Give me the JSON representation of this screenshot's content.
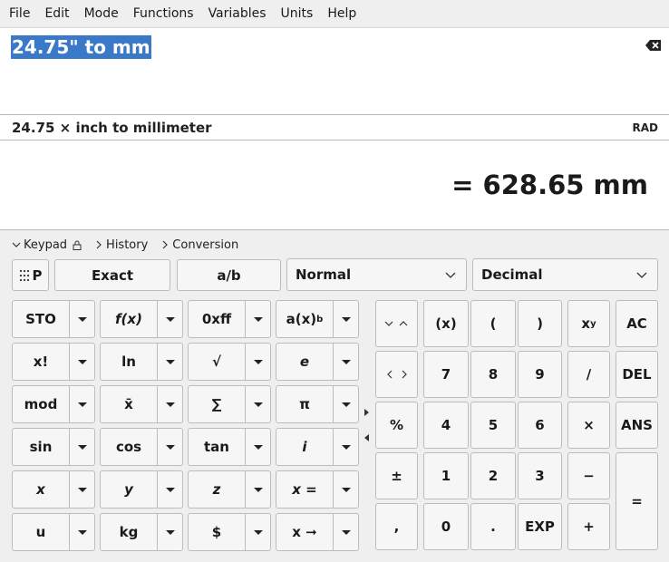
{
  "menu": [
    "File",
    "Edit",
    "Mode",
    "Functions",
    "Variables",
    "Units",
    "Help"
  ],
  "expression": "24.75\" to mm",
  "parsed": "24.75 × inch to millimeter",
  "angle_mode": "RAD",
  "result": "= 628.65 mm",
  "tabs": {
    "keypad": "Keypad",
    "history": "History",
    "conversion": "Conversion"
  },
  "toolbar": {
    "p_label": "P",
    "exact": "Exact",
    "fraction": "a/b",
    "display_mode": "Normal",
    "base": "Decimal"
  },
  "fn_keys": [
    [
      "STO",
      "f(x)",
      "0xff",
      "a(x)"
    ],
    [
      "x!",
      "ln",
      "√",
      "e"
    ],
    [
      "mod",
      "x̄",
      "∑",
      "π"
    ],
    [
      "sin",
      "cos",
      "tan",
      "i"
    ],
    [
      "x",
      "y",
      "z",
      "x ="
    ],
    [
      "u",
      "kg",
      "$",
      "x ➞"
    ]
  ],
  "fn_superscript": "b",
  "numpad": {
    "row1": [
      "(x)",
      "(",
      ")",
      "x",
      "AC"
    ],
    "power_sup": "y",
    "row2": [
      "7",
      "8",
      "9",
      "∕",
      "DEL"
    ],
    "row3": [
      "%",
      "4",
      "5",
      "6",
      "×",
      "ANS"
    ],
    "row4": [
      "±",
      "1",
      "2",
      "3",
      "−"
    ],
    "row5": [
      ",",
      "0",
      ".",
      "EXP",
      "+"
    ],
    "equals": "="
  },
  "icons": {
    "clear": "backspace-icon",
    "updown": "up-down-chevron-icon",
    "leftright": "left-right-chevron-icon",
    "grid": "grid-dots-icon"
  }
}
